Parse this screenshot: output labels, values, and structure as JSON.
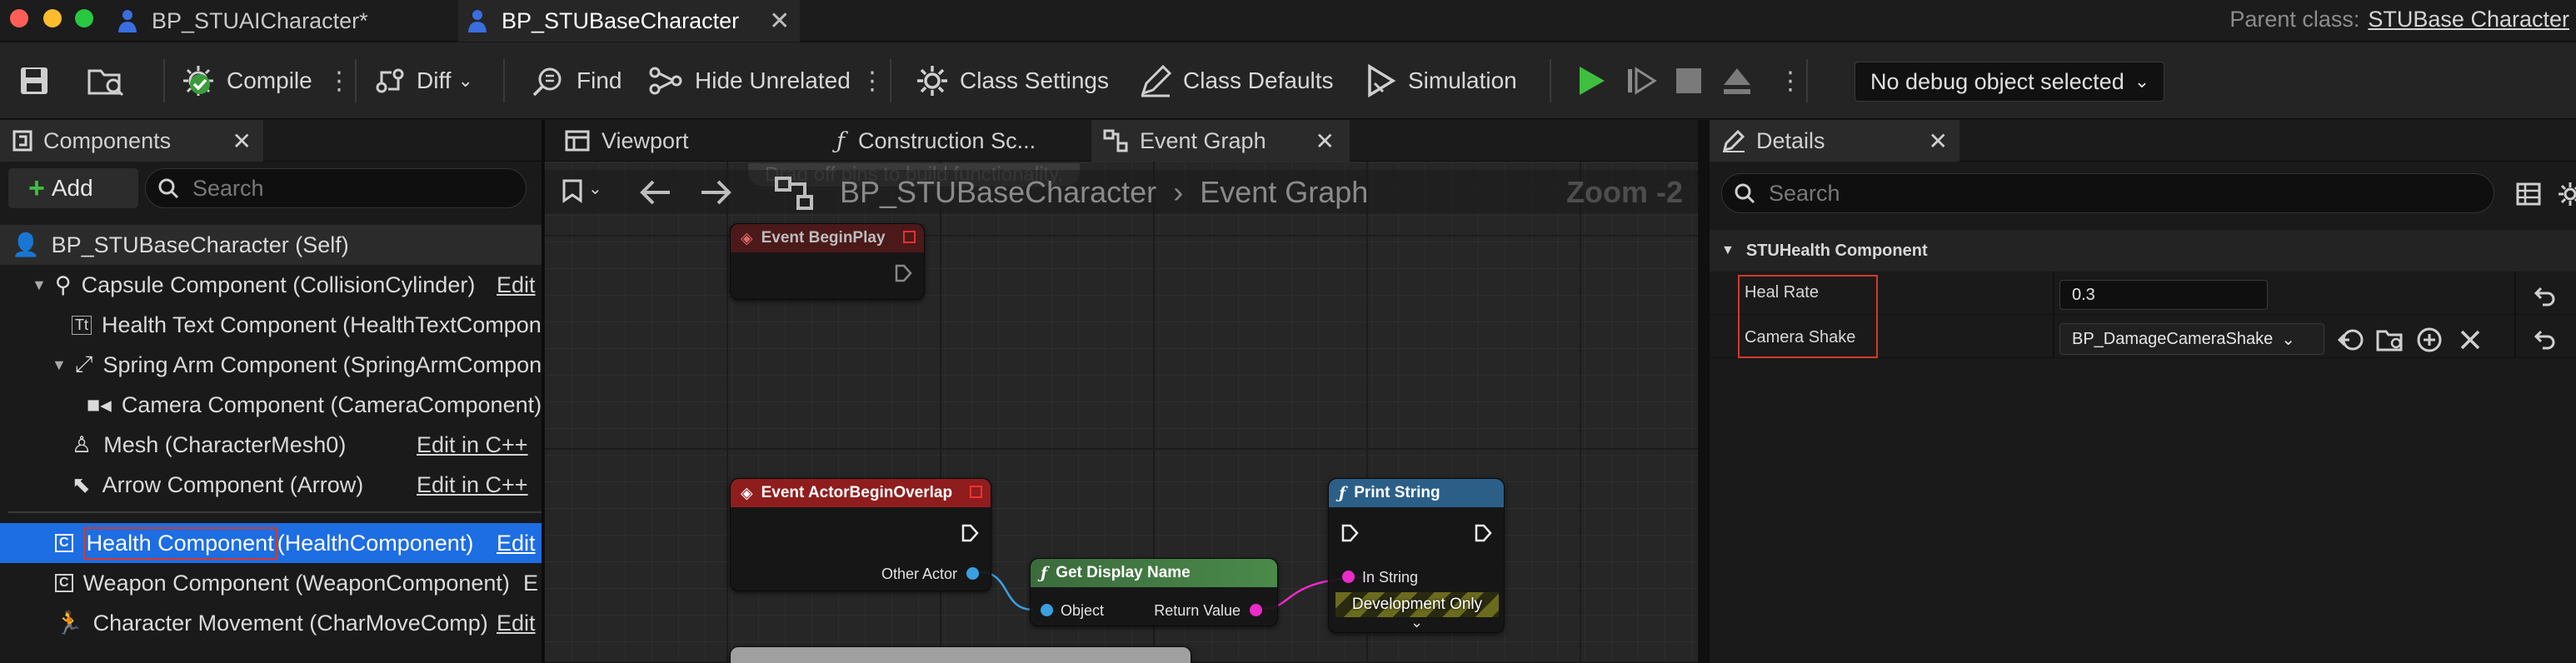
{
  "doc_tabs": [
    {
      "label": "BP_STUAICharacter*",
      "active": false
    },
    {
      "label": "BP_STUBaseCharacter",
      "active": true
    }
  ],
  "parent_class": {
    "label": "Parent class:",
    "value": "STUBase Character"
  },
  "toolbar": {
    "compile": "Compile",
    "diff": "Diff",
    "find": "Find",
    "hide_unrelated": "Hide Unrelated",
    "class_settings": "Class Settings",
    "class_defaults": "Class Defaults",
    "simulation": "Simulation",
    "debug_selector": "No debug object selected"
  },
  "components_panel": {
    "title": "Components",
    "add_label": "Add",
    "search_placeholder": "Search",
    "items": [
      {
        "label": "BP_STUBaseCharacter (Self)",
        "edit": ""
      },
      {
        "label": "Capsule Component (CollisionCylinder)",
        "edit": "Edit"
      },
      {
        "label": "Health Text Component (HealthTextComponent)",
        "edit": ""
      },
      {
        "label": "Spring Arm Component (SpringArmComponent)",
        "edit": ""
      },
      {
        "label": "Camera Component (CameraComponent)",
        "edit": ""
      },
      {
        "label": "Mesh (CharacterMesh0)",
        "edit": "Edit in C++"
      },
      {
        "label": "Arrow Component (Arrow)",
        "edit": "Edit in C++"
      },
      {
        "label_main": "Health Component",
        "label_rest": " (HealthComponent)",
        "edit": "Edit"
      },
      {
        "label": "Weapon Component (WeaponComponent)",
        "edit": "E"
      },
      {
        "label": "Character Movement (CharMoveComp)",
        "edit": "Edit"
      }
    ]
  },
  "center_tabs": [
    {
      "label": "Viewport"
    },
    {
      "label": "Construction Sc..."
    },
    {
      "label": "Event Graph",
      "active": true
    }
  ],
  "graph": {
    "breadcrumb_root": "BP_STUBaseCharacter",
    "breadcrumb_leaf": "Event Graph",
    "zoom": "Zoom -2",
    "hint": "Drag off pins to build functionality.",
    "nodes": {
      "begin_play": "Event BeginPlay",
      "begin_overlap": "Event ActorBeginOverlap",
      "other_actor": "Other Actor",
      "get_display_name": "Get Display Name",
      "object": "Object",
      "return_value": "Return Value",
      "print_string": "Print String",
      "in_string": "In String",
      "dev_only": "Development Only"
    }
  },
  "details_panel": {
    "title": "Details",
    "search_placeholder": "Search",
    "category": "STUHealth Component",
    "properties": [
      {
        "name": "Heal Rate",
        "value": "0.3"
      },
      {
        "name": "Camera Shake",
        "value": "BP_DamageCameraShake"
      }
    ]
  },
  "colors": {
    "selection_blue": "#1d6de3",
    "highlight_red": "#d23a2a",
    "event_node_red": "#8f1d1d",
    "function_node_blue": "#2b5f88",
    "pure_node_green": "#3b6b3c",
    "play_green": "#3fbf3f"
  }
}
